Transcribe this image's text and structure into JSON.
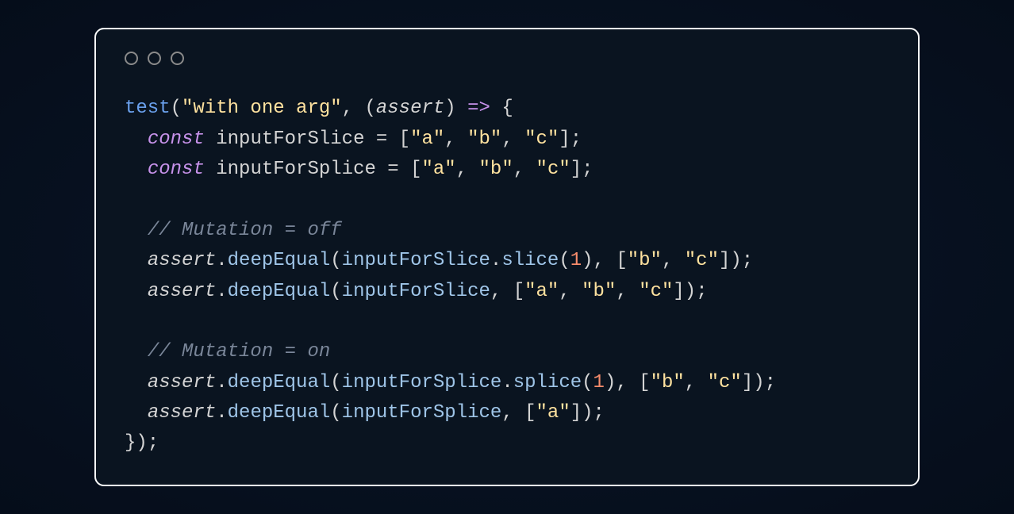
{
  "code": {
    "line1": {
      "func": "test",
      "p1": "(",
      "str": "\"with one arg\"",
      "c1": ", (",
      "param": "assert",
      "c2": ") ",
      "arrow": "=>",
      "c3": " {"
    },
    "line2": {
      "indent": "  ",
      "kw": "const",
      "sp": " ",
      "var": "inputForSlice",
      "eq": " = [",
      "s1": "\"a\"",
      "c1": ", ",
      "s2": "\"b\"",
      "c2": ", ",
      "s3": "\"c\"",
      "end": "];"
    },
    "line3": {
      "indent": "  ",
      "kw": "const",
      "sp": " ",
      "var": "inputForSplice",
      "eq": " = [",
      "s1": "\"a\"",
      "c1": ", ",
      "s2": "\"b\"",
      "c2": ", ",
      "s3": "\"c\"",
      "end": "];"
    },
    "line5": {
      "indent": "  ",
      "comment": "// Mutation = off"
    },
    "line6": {
      "indent": "  ",
      "obj": "assert",
      "dot": ".",
      "method": "deepEqual",
      "p1": "(",
      "arg": "inputForSlice",
      "dot2": ".",
      "method2": "slice",
      "p2": "(",
      "num": "1",
      "p3": "), [",
      "s1": "\"b\"",
      "c1": ", ",
      "s2": "\"c\"",
      "end": "]);"
    },
    "line7": {
      "indent": "  ",
      "obj": "assert",
      "dot": ".",
      "method": "deepEqual",
      "p1": "(",
      "arg": "inputForSlice",
      "c1": ", [",
      "s1": "\"a\"",
      "c2": ", ",
      "s2": "\"b\"",
      "c3": ", ",
      "s3": "\"c\"",
      "end": "]);"
    },
    "line9": {
      "indent": "  ",
      "comment": "// Mutation = on"
    },
    "line10": {
      "indent": "  ",
      "obj": "assert",
      "dot": ".",
      "method": "deepEqual",
      "p1": "(",
      "arg": "inputForSplice",
      "dot2": ".",
      "method2": "splice",
      "p2": "(",
      "num": "1",
      "p3": "), [",
      "s1": "\"b\"",
      "c1": ", ",
      "s2": "\"c\"",
      "end": "]);"
    },
    "line11": {
      "indent": "  ",
      "obj": "assert",
      "dot": ".",
      "method": "deepEqual",
      "p1": "(",
      "arg": "inputForSplice",
      "c1": ", [",
      "s1": "\"a\"",
      "end": "]);"
    },
    "line12": {
      "close": "});"
    }
  }
}
